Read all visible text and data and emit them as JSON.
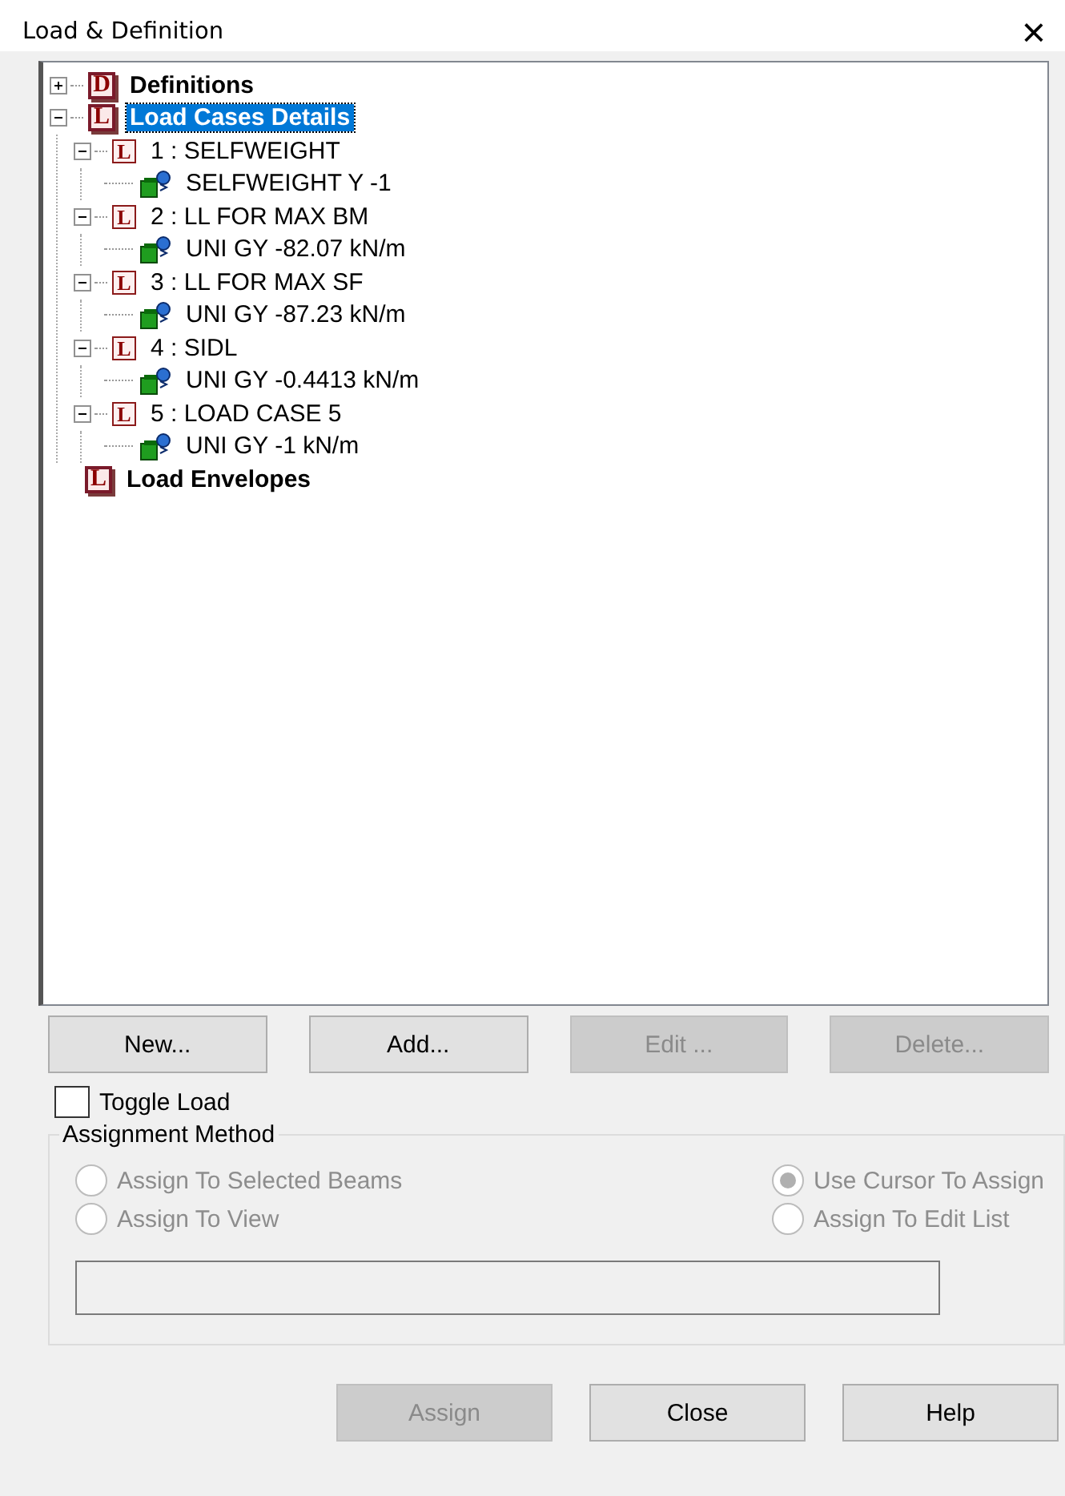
{
  "window": {
    "title": "Load & Definition",
    "close": "×"
  },
  "tree": [
    {
      "kind": "group",
      "badge": "D",
      "label": "Definitions",
      "expanded": false,
      "selected": false
    },
    {
      "kind": "group",
      "badge": "L",
      "label": "Load Cases Details",
      "expanded": true,
      "selected": true,
      "children": [
        {
          "kind": "case",
          "badge": "L",
          "label": "1 : SELFWEIGHT",
          "expanded": true,
          "selected": false,
          "children": [
            {
              "kind": "load",
              "label": "SELFWEIGHT Y -1",
              "selected": false
            }
          ]
        },
        {
          "kind": "case",
          "badge": "L",
          "label": "2 : LL FOR MAX BM",
          "expanded": true,
          "selected": false,
          "children": [
            {
              "kind": "load",
              "label": "UNI GY -82.07 kN/m",
              "selected": false
            }
          ]
        },
        {
          "kind": "case",
          "badge": "L",
          "label": "3 : LL FOR MAX SF",
          "expanded": true,
          "selected": false,
          "children": [
            {
              "kind": "load",
              "label": "UNI GY -87.23 kN/m",
              "selected": false
            }
          ]
        },
        {
          "kind": "case",
          "badge": "L",
          "label": "4 : SIDL",
          "expanded": true,
          "selected": false,
          "children": [
            {
              "kind": "load",
              "label": "UNI GY -0.4413 kN/m",
              "selected": false
            }
          ]
        },
        {
          "kind": "case",
          "badge": "L",
          "label": "5 : LOAD CASE 5",
          "expanded": true,
          "selected": false,
          "children": [
            {
              "kind": "load",
              "label": "UNI GY -1 kN/m",
              "selected": false
            }
          ]
        }
      ]
    },
    {
      "kind": "group",
      "badge": "L",
      "label": "Load Envelopes",
      "selected": false
    }
  ],
  "tree_buttons": [
    {
      "label": "New...",
      "disabled": false
    },
    {
      "label": "Add...",
      "disabled": false
    },
    {
      "label": "Edit ...",
      "disabled": true
    },
    {
      "label": "Delete...",
      "disabled": true
    }
  ],
  "toggle_load": {
    "label": "Toggle Load",
    "checked": false
  },
  "assignment_method": {
    "title": "Assignment Method",
    "disabled": true,
    "options": [
      {
        "label": "Assign To Selected Beams",
        "selected": false
      },
      {
        "label": "Use Cursor To Assign",
        "selected": true
      },
      {
        "label": "Assign To View",
        "selected": false
      },
      {
        "label": "Assign To Edit List",
        "selected": false
      }
    ]
  },
  "footer_buttons": [
    {
      "label": "Assign",
      "disabled": true
    },
    {
      "label": "Close",
      "disabled": false
    },
    {
      "label": "Help",
      "disabled": false
    }
  ]
}
